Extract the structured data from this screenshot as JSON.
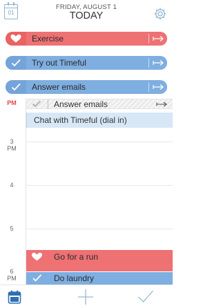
{
  "header": {
    "calendar_day": "01",
    "date": "FRIDAY, AUGUST 1",
    "title": "TODAY"
  },
  "pinned_tasks": [
    {
      "label": "Exercise",
      "color": "#ee7173",
      "icon": "heart-icon"
    },
    {
      "label": "Try out Timeful",
      "color": "#7faee0",
      "icon": "check-icon"
    },
    {
      "label": "Answer emails",
      "color": "#7faee0",
      "icon": "check-icon"
    }
  ],
  "timeline": {
    "current_marker": "PM",
    "hours": [
      {
        "hour": "3",
        "suffix": "PM"
      },
      {
        "hour": "4",
        "suffix": ""
      },
      {
        "hour": "5",
        "suffix": ""
      },
      {
        "hour": "6",
        "suffix": "PM"
      }
    ],
    "events": {
      "done": {
        "label": "Answer emails"
      },
      "chat": {
        "label": "Chat with Timeful (dial in)"
      },
      "run": {
        "label": "Go for a run",
        "color": "#ee7173"
      },
      "laundry": {
        "label": "Do laundry",
        "color": "#7faee0"
      }
    }
  },
  "toolbar": {
    "accent": "#2f6fb3",
    "items": [
      "calendar-icon",
      "add-icon",
      "checkmark-icon"
    ]
  }
}
